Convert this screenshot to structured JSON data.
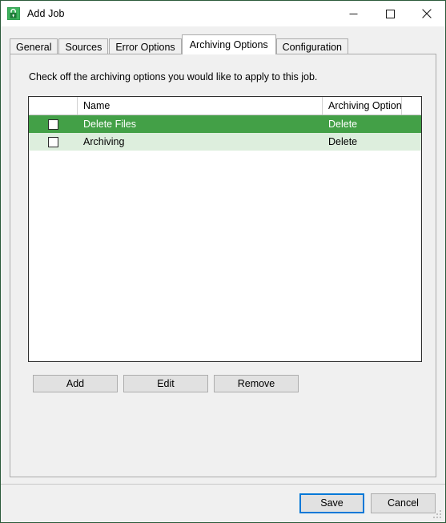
{
  "window": {
    "title": "Add Job",
    "app_icon": "lock-job-icon",
    "accent_color": "#43a047",
    "focus_color": "#0078d7",
    "controls": [
      {
        "name": "minimize",
        "glyph": "minimize-icon"
      },
      {
        "name": "maximize",
        "glyph": "maximize-icon"
      },
      {
        "name": "close",
        "glyph": "close-icon"
      }
    ]
  },
  "tabs": [
    {
      "label": "General",
      "active": false
    },
    {
      "label": "Sources",
      "active": false
    },
    {
      "label": "Error Options",
      "active": false
    },
    {
      "label": "Archiving Options",
      "active": true
    },
    {
      "label": "Configuration",
      "active": false
    }
  ],
  "panel": {
    "instruction": "Check off the archiving options you would like to apply to this job."
  },
  "grid": {
    "columns": [
      "",
      "Name",
      "Archiving Option",
      ""
    ],
    "rows": [
      {
        "checked": false,
        "name": "Delete Files",
        "option": "Delete",
        "selected": true
      },
      {
        "checked": false,
        "name": "Archiving",
        "option": "Delete",
        "selected": false
      }
    ]
  },
  "actions": {
    "add": "Add",
    "edit": "Edit",
    "remove": "Remove"
  },
  "footer": {
    "save": "Save",
    "cancel": "Cancel"
  }
}
